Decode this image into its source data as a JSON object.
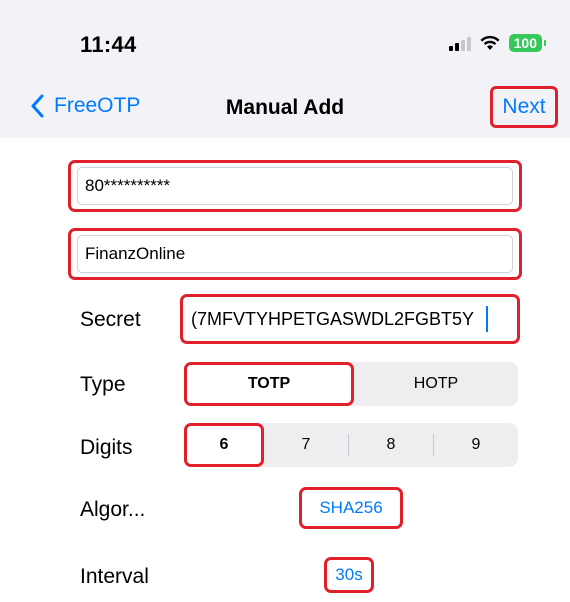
{
  "status_bar": {
    "time": "11:44",
    "battery": "100",
    "signal_icon": "cellular-signal-icon",
    "wifi_icon": "wifi-icon"
  },
  "nav": {
    "back_label": "FreeOTP",
    "title": "Manual Add",
    "next_label": "Next"
  },
  "form": {
    "issuer_value": "80**********",
    "account_value": "FinanzOnline",
    "secret_label": "Secret",
    "secret_value": "(7MFVTYHPETGASWDL2FGBT5Y",
    "type_label": "Type",
    "type_options": [
      "TOTP",
      "HOTP"
    ],
    "type_selected": "TOTP",
    "digits_label": "Digits",
    "digits_options": [
      "6",
      "7",
      "8",
      "9"
    ],
    "digits_selected": "6",
    "algorithm_label": "Algor...",
    "algorithm_value": "SHA256",
    "interval_label": "Interval",
    "interval_value": "30s"
  },
  "colors": {
    "accent": "#007aff",
    "highlight": "#e0202b",
    "battery": "#34c759"
  }
}
